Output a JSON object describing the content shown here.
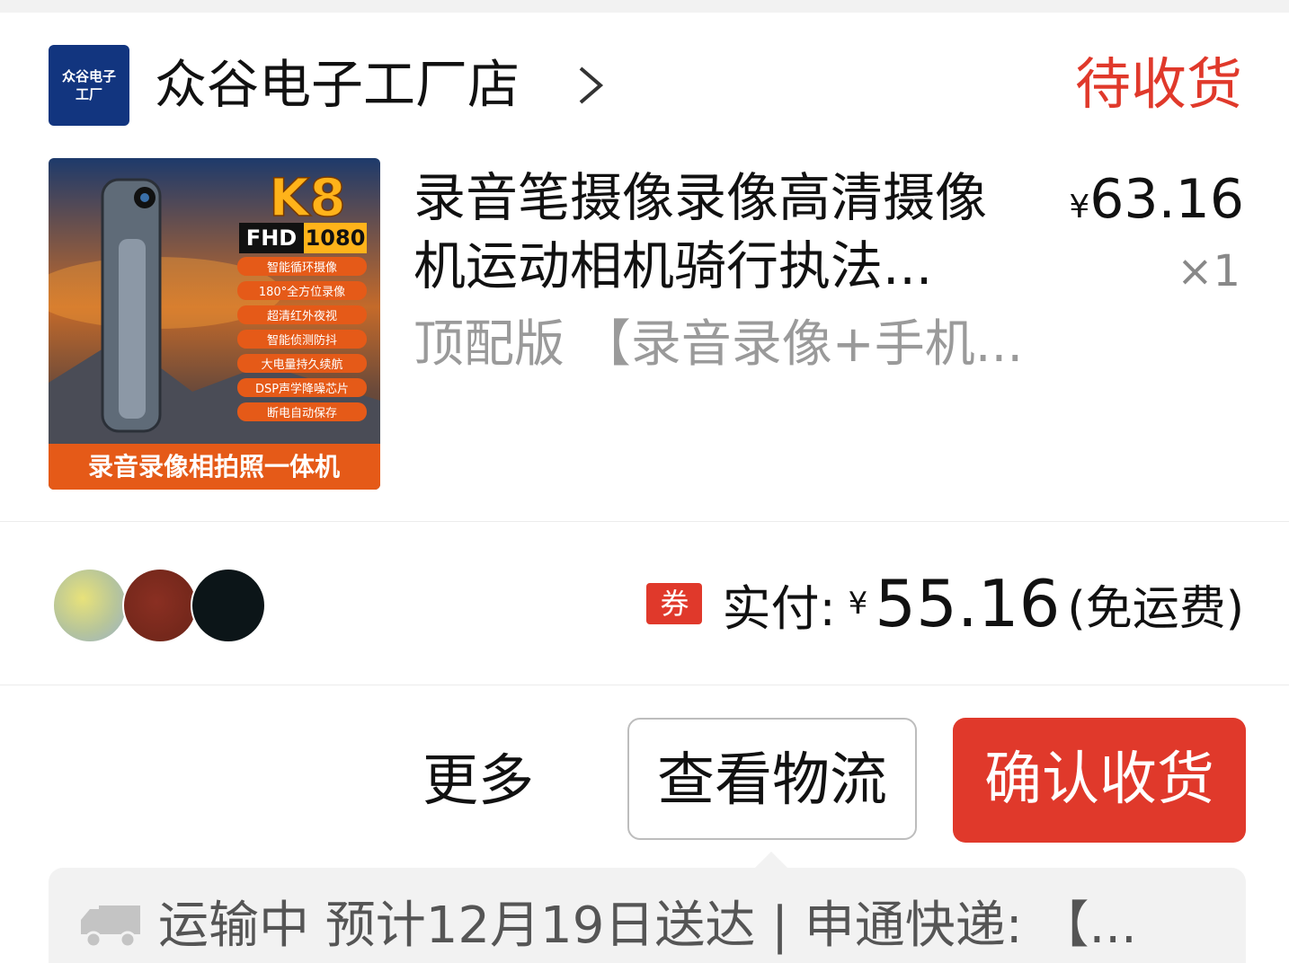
{
  "shop": {
    "logo_text_line1": "众谷电子",
    "logo_text_line2": "工厂",
    "name": "众谷电子工厂店"
  },
  "order": {
    "status": "待收货"
  },
  "product": {
    "title": "录音笔摄像录像高清摄像机运动相机骑行执法...",
    "sku": "顶配版 【录音录像+手机...",
    "price_symbol": "¥",
    "price": "63.16",
    "quantity": "×1",
    "image_text": {
      "model": "K8",
      "badge_fhd": "FHD",
      "badge_1080": "1080",
      "features": [
        "智能循环摄像",
        "180°全方位录像",
        "超清红外夜视",
        "智能侦测防抖",
        "大电量持久续航",
        "DSP声学降噪芯片",
        "断电自动保存"
      ],
      "banner": "录音录像相拍照一体机"
    }
  },
  "payment": {
    "coupon_badge": "券",
    "label": "实付:",
    "symbol": "¥",
    "amount": "55.16",
    "shipping_note": "(免运费)"
  },
  "actions": {
    "more": "更多",
    "view_logistics": "查看物流",
    "confirm_receipt": "确认收货"
  },
  "logistics": {
    "text": "运输中 预计12月19日送达 | 申通快递: 【..."
  },
  "colors": {
    "accent_red": "#e0392b",
    "shop_logo_blue": "#12357f"
  },
  "icons": [
    "chevron-right-icon",
    "truck-icon"
  ]
}
